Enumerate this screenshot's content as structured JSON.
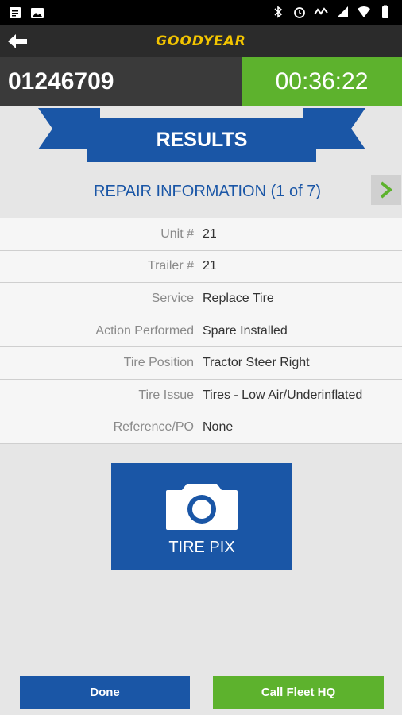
{
  "header": {
    "brand": "GOODYEAR"
  },
  "ticket": {
    "number": "01246709",
    "timer": "00:36:22"
  },
  "results_banner": {
    "label": "RESULTS"
  },
  "section": {
    "title": "REPAIR INFORMATION (1 of 7)"
  },
  "repair_info": [
    {
      "label": "Unit #",
      "value": "21"
    },
    {
      "label": "Trailer #",
      "value": "21"
    },
    {
      "label": "Service",
      "value": "Replace Tire"
    },
    {
      "label": "Action Performed",
      "value": "Spare Installed"
    },
    {
      "label": "Tire Position",
      "value": "Tractor Steer Right"
    },
    {
      "label": "Tire Issue",
      "value": "Tires - Low Air/Underinflated"
    },
    {
      "label": "Reference/PO",
      "value": "None"
    }
  ],
  "tire_pix": {
    "label": "TIRE PIX",
    "icon": "camera-icon"
  },
  "buttons": {
    "done": "Done",
    "call": "Call Fleet HQ"
  },
  "colors": {
    "blue": "#1a56a6",
    "green": "#5db22d",
    "dark": "#3a3a3a",
    "brand_yellow": "#f2c400"
  }
}
